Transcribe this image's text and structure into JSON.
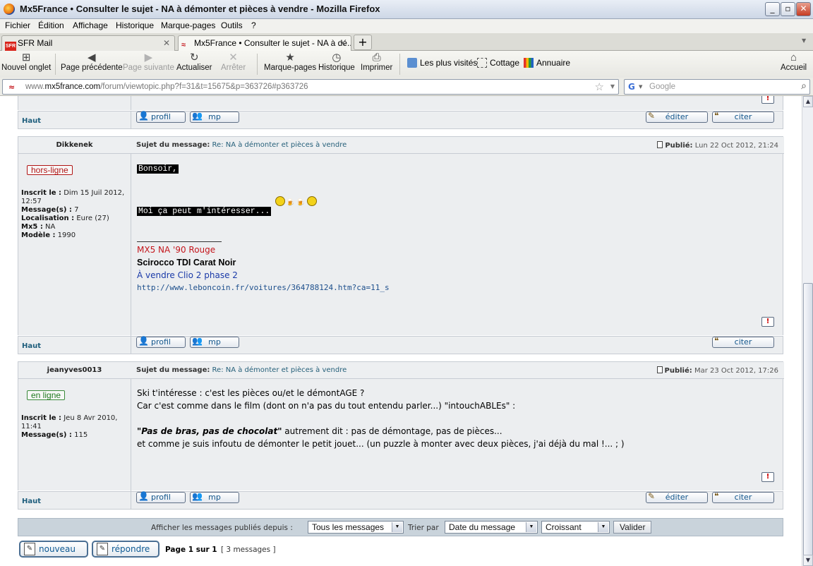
{
  "window": {
    "title": "Mx5France • Consulter le sujet - NA à démonter et pièces à vendre - Mozilla Firefox",
    "min": "_",
    "max": "▫",
    "close": "✕"
  },
  "menu": [
    "Fichier",
    "Édition",
    "Affichage",
    "Historique",
    "Marque-pages",
    "Outils",
    "?"
  ],
  "tabs": [
    {
      "label": "SFR Mail",
      "favicon": "SFR"
    },
    {
      "label": "Mx5France • Consulter le sujet - NA à dé..."
    }
  ],
  "toolbar": {
    "new_tab": "Nouvel onglet",
    "back": "Page précédente",
    "forward": "Page suivante",
    "reload": "Actualiser",
    "stop": "Arrêter",
    "bookmarks": "Marque-pages",
    "history": "Historique",
    "print": "Imprimer",
    "home": "Accueil",
    "bookmark_links": [
      "Les plus visités",
      "Cottage",
      "Annuaire"
    ]
  },
  "url": {
    "prefix": "www.",
    "domain": "mx5france.com",
    "path": "/forum/viewtopic.php?f=31&t=15675&p=363726#p363726"
  },
  "search": {
    "engine": "G",
    "placeholder": "Google"
  },
  "forum": {
    "top_link": "Haut",
    "btn_profile": "profil",
    "btn_pm": "mp",
    "btn_edit": "éditer",
    "btn_quote": "citer",
    "report": "!",
    "subject_label": "Sujet du message:",
    "published_label": "Publié:",
    "posts": [
      {
        "author": "Dikkenek",
        "subject": "Re: NA à démonter et pièces à vendre",
        "date": "Lun 22 Oct 2012, 21:24",
        "status": "hors-ligne",
        "profile": [
          {
            "k": "Inscrit le :",
            "v": "Dim 15 Juil 2012, 12:57"
          },
          {
            "k": "Message(s) :",
            "v": "7"
          },
          {
            "k": "Localisation :",
            "v": "Eure (27)"
          },
          {
            "k": "Mx5 :",
            "v": "NA"
          },
          {
            "k": "Modèle :",
            "v": "1990"
          }
        ],
        "lines": [
          "Bonsoir,",
          "Moi ça peut m'intéresser..."
        ],
        "signature": {
          "red": "MX5 NA '90 Rouge",
          "black": "Scirocco TDI Carat Noir",
          "blue": "À vendre Clio 2 phase 2",
          "link": "http://www.leboncoin.fr/voitures/364788124.htm?ca=11_s"
        }
      },
      {
        "author": "jeanyves0013",
        "subject": "Re: NA à démonter et pièces à vendre",
        "date": "Mar 23 Oct 2012, 17:26",
        "status": "en ligne",
        "profile": [
          {
            "k": "Inscrit le :",
            "v": "Jeu 8 Avr 2010, 11:41"
          },
          {
            "k": "Message(s) :",
            "v": "115"
          }
        ],
        "lines": [
          "Ski t'intéresse : c'est les pièces ou/et le démontAGE ?",
          "Car c'est comme dans le film (dont on n'a pas du tout entendu parler...) \"intouchABLEs\" :",
          "\"Pas de bras, pas de chocolat\"",
          " autrement dit : pas de démontage, pas de pièces...",
          "et comme je suis infoutu de démonter le petit jouet... (un puzzle à monter avec deux pièces, j'ai déjà du mal !... ; )"
        ]
      }
    ],
    "filter": {
      "display_label": "Afficher les messages publiés depuis :",
      "display_value": "Tous les messages",
      "sort_label": "Trier par",
      "sort_value": "Date du message",
      "order_value": "Croissant",
      "submit": "Valider"
    },
    "actions": {
      "new": "nouveau",
      "reply": "répondre",
      "pagination": "Page 1 sur 1",
      "count": "[ 3 messages ]"
    }
  }
}
